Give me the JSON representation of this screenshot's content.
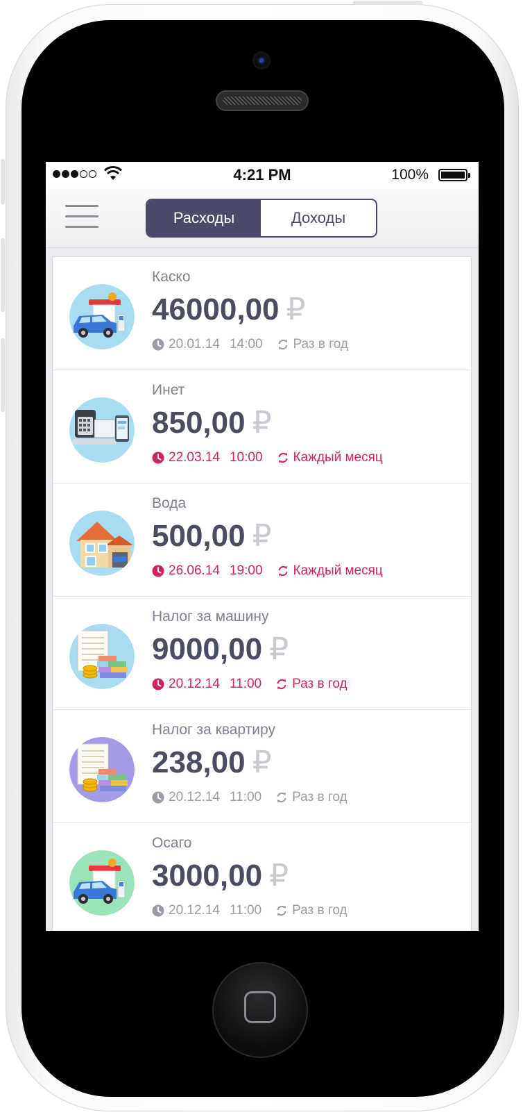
{
  "status_bar": {
    "time": "4:21 PM",
    "battery_percent": "100%",
    "signal_bars": 3,
    "signal_total": 5
  },
  "nav": {
    "tabs": [
      {
        "label": "Расходы",
        "active": true
      },
      {
        "label": "Доходы",
        "active": false
      }
    ]
  },
  "colors": {
    "accent": "#4a4a6a",
    "alert": "#d1245a",
    "muted": "#9a9ca6",
    "amount": "#4a4d60"
  },
  "currency_symbol": "₽",
  "expenses": [
    {
      "title": "Каско",
      "amount": "46000,00",
      "date": "20.01.14",
      "time": "14:00",
      "repeat": "Раз в год",
      "overdue": false,
      "icon": "gas-station-car-icon",
      "circle": "#a8dcf2"
    },
    {
      "title": "Инет",
      "amount": "850,00",
      "date": "22.03.14",
      "time": "10:00",
      "repeat": "Каждый месяц",
      "overdue": true,
      "icon": "phone-internet-icon",
      "circle": "#a8dcf2"
    },
    {
      "title": "Вода",
      "amount": "500,00",
      "date": "26.06.14",
      "time": "19:00",
      "repeat": "Каждый месяц",
      "overdue": true,
      "icon": "house-icon",
      "circle": "#a8dcf2"
    },
    {
      "title": "Налог за машину",
      "amount": "9000,00",
      "date": "20.12.14",
      "time": "11:00",
      "repeat": "Раз в год",
      "overdue": true,
      "icon": "tax-money-icon",
      "circle": "#a8dcf2"
    },
    {
      "title": "Налог за квартиру",
      "amount": "238,00",
      "date": "20.12.14",
      "time": "11:00",
      "repeat": "Раз в год",
      "overdue": false,
      "icon": "tax-money-icon",
      "circle": "#a39ae8"
    },
    {
      "title": "Осаго",
      "amount": "3000,00",
      "date": "20.12.14",
      "time": "11:00",
      "repeat": "Раз в год",
      "overdue": false,
      "icon": "gas-station-car-icon",
      "circle": "#9be3b9"
    }
  ]
}
